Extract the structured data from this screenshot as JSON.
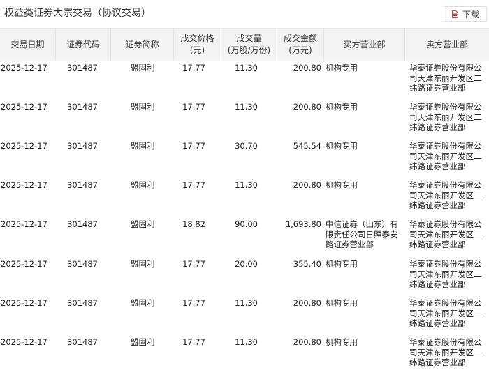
{
  "title": "权益类证券大宗交易（协议交易）",
  "download": {
    "label": "下载",
    "icon": "download-file-icon",
    "icon_color": "#d9363e"
  },
  "columns": [
    "交易日期",
    "证券代码",
    "证券简称",
    "成交价格\n(元)",
    "成交量\n(万股/万份)",
    "成交金额\n(万元)",
    "买方营业部",
    "卖方营业部"
  ],
  "rows": [
    [
      "2025-12-17",
      "301487",
      "盟固利",
      "17.77",
      "11.30",
      "200.80",
      "机构专用",
      "华泰证券股份有限公司天津东丽开发区二纬路证券营业部"
    ],
    [
      "2025-12-17",
      "301487",
      "盟固利",
      "17.77",
      "11.30",
      "200.80",
      "机构专用",
      "华泰证券股份有限公司天津东丽开发区二纬路证券营业部"
    ],
    [
      "2025-12-17",
      "301487",
      "盟固利",
      "17.77",
      "30.70",
      "545.54",
      "机构专用",
      "华泰证券股份有限公司天津东丽开发区二纬路证券营业部"
    ],
    [
      "2025-12-17",
      "301487",
      "盟固利",
      "17.77",
      "11.30",
      "200.80",
      "机构专用",
      "华泰证券股份有限公司天津东丽开发区二纬路证券营业部"
    ],
    [
      "2025-12-17",
      "301487",
      "盟固利",
      "18.82",
      "90.00",
      "1,693.80",
      "中信证券（山东）有限责任公司日照泰安路证券营业部",
      "华泰证券股份有限公司天津东丽开发区二纬路证券营业部"
    ],
    [
      "2025-12-17",
      "301487",
      "盟固利",
      "17.77",
      "20.00",
      "355.40",
      "机构专用",
      "华泰证券股份有限公司天津东丽开发区二纬路证券营业部"
    ],
    [
      "2025-12-17",
      "301487",
      "盟固利",
      "17.77",
      "11.30",
      "200.80",
      "机构专用",
      "华泰证券股份有限公司天津东丽开发区二纬路证券营业部"
    ],
    [
      "2025-12-17",
      "301487",
      "盟固利",
      "17.77",
      "11.30",
      "200.80",
      "机构专用",
      "华泰证券股份有限公司天津东丽开发区二纬路证券营业部"
    ]
  ]
}
